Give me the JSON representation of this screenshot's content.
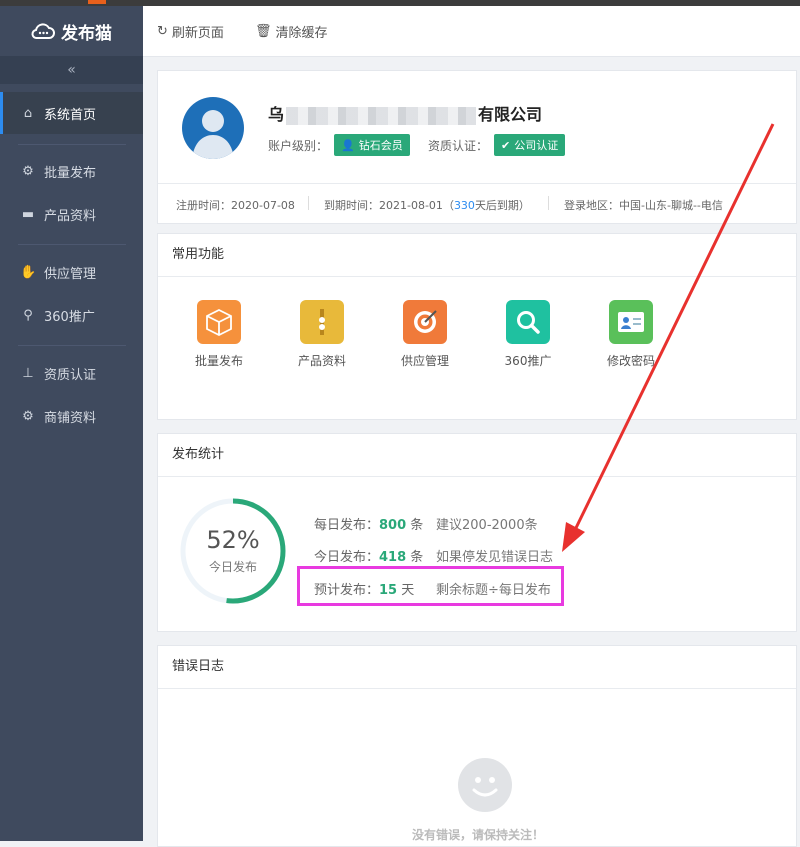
{
  "app": {
    "logo_text": "发布猫",
    "collapse_glyph": "«"
  },
  "sidebar": {
    "items": [
      {
        "label": "系统首页",
        "icon": "home-icon",
        "active": true
      },
      {
        "label": "批量发布",
        "icon": "gear-icon"
      },
      {
        "label": "产品资料",
        "icon": "folder-icon"
      },
      {
        "label": "供应管理",
        "icon": "handshake-icon"
      },
      {
        "label": "360推广",
        "icon": "search-icon"
      },
      {
        "label": "资质认证",
        "icon": "stamp-icon"
      },
      {
        "label": "商铺资料",
        "icon": "gear-icon"
      }
    ]
  },
  "topbar": {
    "refresh_label": "刷新页面",
    "clear_cache_label": "清除缓存"
  },
  "profile": {
    "company_prefix": "乌",
    "company_suffix": "有限公司",
    "account_level_label": "账户级别：",
    "account_level_value": "钻石会员",
    "qualification_label": "资质认证：",
    "qualification_value": "公司认证",
    "register_date": "注册时间：2020-07-08",
    "expire_date": "到期时间：2021-08-01",
    "expire_open": "（",
    "expire_days": "330",
    "expire_close": "天后到期）",
    "login_region": "登录地区：中国-山东-聊城--电信"
  },
  "common_functions": {
    "title": "常用功能",
    "items": [
      {
        "label": "批量发布",
        "color": "#f5913c"
      },
      {
        "label": "产品资料",
        "color": "#e8b93a"
      },
      {
        "label": "供应管理",
        "color": "#f07a3a"
      },
      {
        "label": "360推广",
        "color": "#1fc1a0"
      },
      {
        "label": "修改密码",
        "color": "#5ac05a"
      }
    ]
  },
  "publish_stats": {
    "title": "发布统计",
    "percent": "52%",
    "percent_value": 52,
    "percent_caption": "今日发布",
    "daily": {
      "label": "每日发布：",
      "value": "800",
      "unit": " 条",
      "hint": "建议200-2000条"
    },
    "today": {
      "label": "今日发布：",
      "value": "418",
      "unit": " 条",
      "hint": "如果停发见错误日志"
    },
    "estimate": {
      "label": "预计发布：",
      "value": "15",
      "unit": " 天",
      "hint": "剩余标题÷每日发布"
    }
  },
  "error_log": {
    "title": "错误日志",
    "empty_text": "没有错误，请保持关注！"
  },
  "colors": {
    "accent": "#2aa879",
    "sidebar": "#3f4a5e",
    "highlight": "#e83ae0",
    "arrow": "#e8312e"
  }
}
